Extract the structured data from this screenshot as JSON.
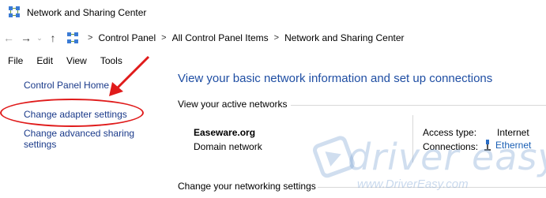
{
  "window": {
    "title": "Network and Sharing Center"
  },
  "address_bar": {
    "breadcrumbs": [
      "Control Panel",
      "All Control Panel Items",
      "Network and Sharing Center"
    ],
    "separator": ">"
  },
  "menu": [
    "File",
    "Edit",
    "View",
    "Tools"
  ],
  "sidebar": {
    "home": "Control Panel Home",
    "adapter": "Change adapter settings",
    "advanced": "Change advanced sharing settings"
  },
  "main": {
    "title": "View your basic network information and set up connections",
    "active_networks_heading": "View your active networks",
    "network_name": "Easeware.org",
    "network_type": "Domain network",
    "access_type_label": "Access type:",
    "access_type_value": "Internet",
    "connections_label": "Connections:",
    "connections_value": "Ethernet",
    "change_settings_heading": "Change your networking settings"
  },
  "watermark": {
    "brand": "driver easy",
    "url": "www.DriverEasy.com"
  },
  "colors": {
    "link": "#1a3a8a",
    "title": "#1f4ea3",
    "annotation": "#e01b1b"
  }
}
